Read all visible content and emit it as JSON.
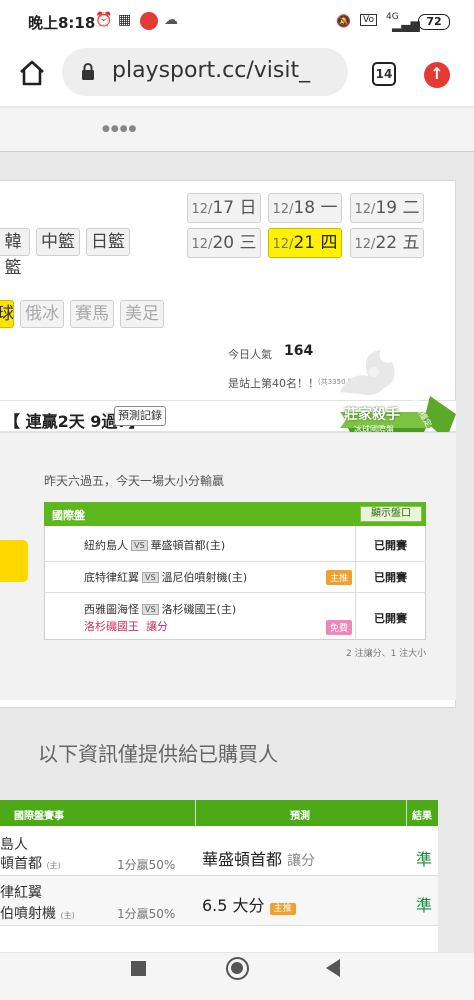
{
  "status_bar": {
    "time": "晚上8:18",
    "battery": "72",
    "network": "4G"
  },
  "browser": {
    "url": "playsport.cc/visit_",
    "tab_count": "14"
  },
  "sports_tabs": {
    "row1": [
      "韓籃",
      "中籃",
      "日籃"
    ],
    "row2": [
      "球",
      "俄冰",
      "賽馬",
      "美足"
    ]
  },
  "dates": [
    {
      "md": "12/",
      "d": "17",
      "w": "日",
      "active": false
    },
    {
      "md": "12/",
      "d": "18",
      "w": "一",
      "active": false
    },
    {
      "md": "12/",
      "d": "19",
      "w": "二",
      "active": false
    },
    {
      "md": "12/",
      "d": "20",
      "w": "三",
      "active": false
    },
    {
      "md": "12/",
      "d": "21",
      "w": "四",
      "active": true
    },
    {
      "md": "12/",
      "d": "22",
      "w": "五",
      "active": false
    }
  ],
  "popularity": {
    "label": "今日人氣",
    "value": "164",
    "rank_text": "是站上第40名！！",
    "total_note": "(共3350人)"
  },
  "streak": {
    "text": "【 連贏2天 9過7】",
    "record_button": "預測記錄"
  },
  "badge": {
    "title": "莊家殺手",
    "subtitle": "冰球國際盤",
    "ribbon": "長期穩定"
  },
  "summary_note": "昨天六過五，今天一場大小分輸贏",
  "games_table": {
    "header": "國際盤",
    "show_button": "顯示盤口",
    "rows": [
      {
        "away": "紐約島人",
        "home": "華盛頓首都(主)",
        "tag": "",
        "pick": "",
        "pick_tag": "",
        "status": "已開賽"
      },
      {
        "away": "底特律紅翼",
        "home": "溫尼伯噴射機(主)",
        "tag": "主推",
        "pick": "",
        "pick_tag": "",
        "status": "已開賽"
      },
      {
        "away": "西雅圖海怪",
        "home": "洛杉磯國王(主)",
        "tag": "",
        "pick": "洛杉磯國王",
        "pick_tag": "讓分",
        "free_tag": "免費",
        "status": "已開賽"
      }
    ],
    "footnote": "2 注讓分、1 注大小"
  },
  "buyer_note": "以下資訊僅提供給已購買人",
  "prediction_table": {
    "headers": [
      "國際盤賽事",
      "預測",
      "結果"
    ],
    "rows": [
      {
        "team1": "島人",
        "team2": "頓首都",
        "home_mark": "(主)",
        "right": "1分贏50%",
        "pick": "華盛頓首都",
        "pick_type": "讓分",
        "tag": "",
        "result": "準"
      },
      {
        "team1": "律紅翼",
        "team2": "伯噴射機",
        "home_mark": "(主)",
        "right": "1分贏50%",
        "pick": "6.5 大分",
        "pick_type": "",
        "tag": "主推",
        "result": "準"
      }
    ]
  }
}
